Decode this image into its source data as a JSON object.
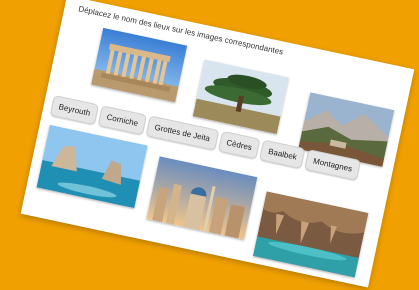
{
  "instruction": "Déplacez le nom des lieux sur les images correspondantes",
  "chips": [
    "Beyrouth",
    "Corniche",
    "Grottes de Jeita",
    "Cèdres",
    "Baalbek",
    "Montagnes"
  ],
  "accent": "#F0A000"
}
